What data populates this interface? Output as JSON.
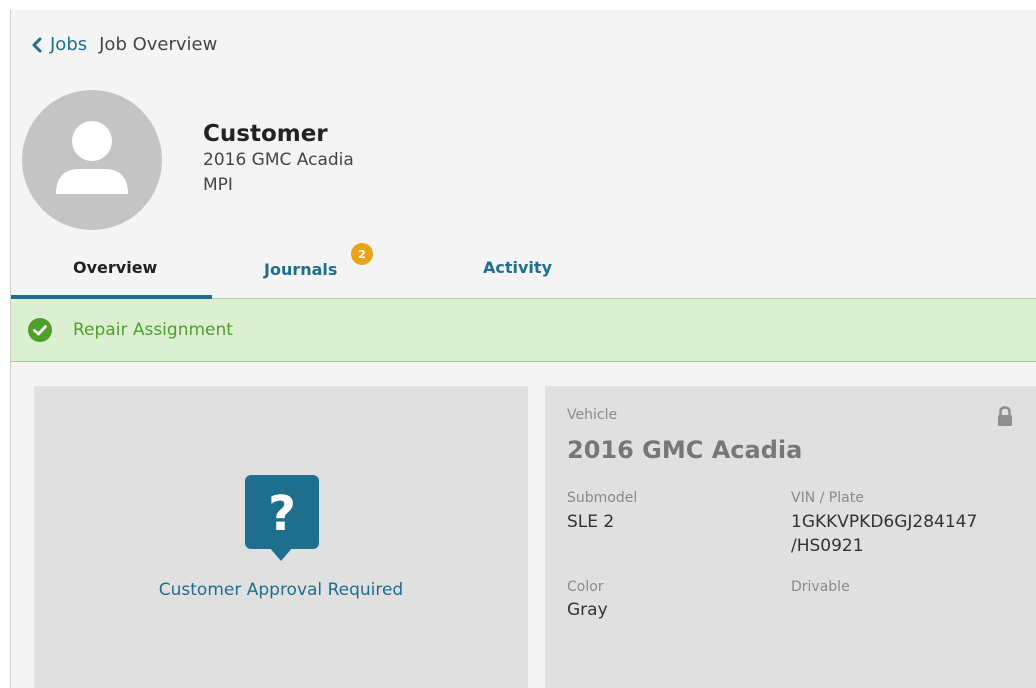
{
  "breadcrumb": {
    "back_label": "Jobs",
    "current": "Job Overview"
  },
  "header": {
    "name": "Customer",
    "vehicle": "2016 GMC Acadia",
    "job_type": "MPI"
  },
  "tabs": [
    {
      "label": "Overview",
      "active": true
    },
    {
      "label": "Journals",
      "badge": "2"
    },
    {
      "label": "Activity"
    }
  ],
  "status": {
    "text": "Repair Assignment",
    "color": "#4e9f2e"
  },
  "approval_card": {
    "text": "Customer Approval Required"
  },
  "vehicle_card": {
    "section_label": "Vehicle",
    "title": "2016 GMC Acadia",
    "submodel_label": "Submodel",
    "submodel": "SLE 2",
    "vin_label": "VIN / Plate",
    "vin": "1GKKVPKD6GJ284147",
    "plate": "/HS0921",
    "color_label": "Color",
    "color": "Gray",
    "drivable_label": "Drivable"
  },
  "colors": {
    "accent": "#1e6f8d",
    "badge": "#e8a317",
    "success": "#4e9f2e"
  }
}
